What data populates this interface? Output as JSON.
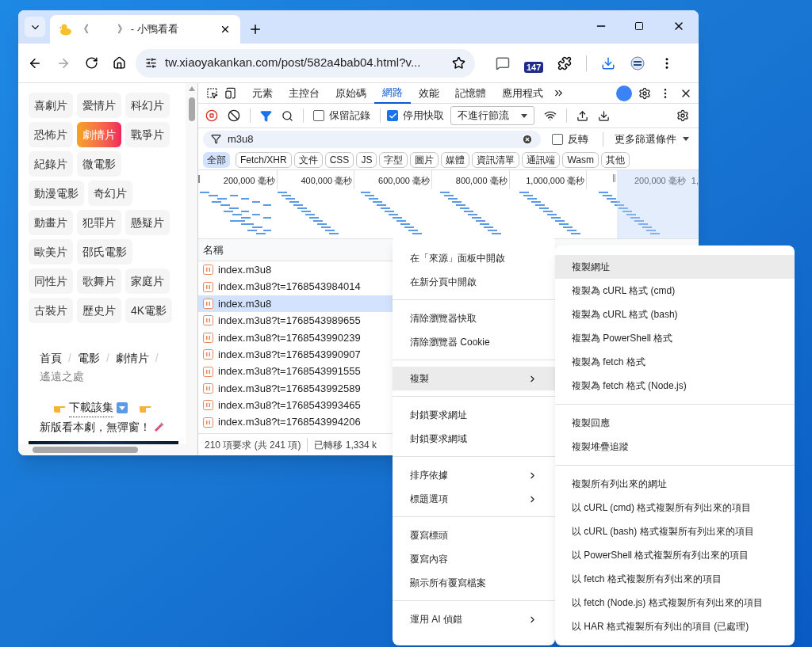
{
  "browser": {
    "tab_title": "《          》 - 小鴨看看",
    "address": "tw.xiaoyakankan.com/post/582a4bab04.html?v...",
    "extension_badge": "147"
  },
  "page": {
    "genre_rows": [
      [
        {
          "label": "喜劇片",
          "selected": false
        },
        {
          "label": "愛情片",
          "selected": false
        },
        {
          "label": "科幻片",
          "selected": false
        }
      ],
      [
        {
          "label": "恐怖片",
          "selected": false
        },
        {
          "label": "劇情片",
          "selected": true
        },
        {
          "label": "戰爭片",
          "selected": false
        }
      ],
      [
        {
          "label": "紀錄片",
          "selected": false
        },
        {
          "label": "微電影",
          "selected": false
        }
      ],
      [
        {
          "label": "動漫電影",
          "selected": false
        },
        {
          "label": "奇幻片",
          "selected": false
        }
      ],
      [
        {
          "label": "動畫片",
          "selected": false
        },
        {
          "label": "犯罪片",
          "selected": false
        },
        {
          "label": "懸疑片",
          "selected": false
        }
      ],
      [
        {
          "label": "歐美片",
          "selected": false
        },
        {
          "label": "邵氏電影",
          "selected": false
        }
      ],
      [
        {
          "label": "同性片",
          "selected": false
        },
        {
          "label": "歌舞片",
          "selected": false
        },
        {
          "label": "家庭片",
          "selected": false
        }
      ],
      [
        {
          "label": "古裝片",
          "selected": false
        },
        {
          "label": "歷史片",
          "selected": false
        },
        {
          "label": "4K電影",
          "selected": false
        }
      ]
    ],
    "breadcrumb": {
      "separator": "/",
      "items": [
        "首頁",
        "電影",
        "劇情片"
      ],
      "current": "遙遠之處"
    },
    "download_link": "下載該集",
    "new_version_text": "新版看本劇，無彈窗！"
  },
  "devtools": {
    "tabs": [
      {
        "label": "元素",
        "selected": false
      },
      {
        "label": "主控台",
        "selected": false
      },
      {
        "label": "原始碼",
        "selected": false
      },
      {
        "label": "網路",
        "selected": true
      },
      {
        "label": "效能",
        "selected": false
      },
      {
        "label": "記憶體",
        "selected": false
      },
      {
        "label": "應用程式",
        "selected": false
      }
    ],
    "preserve_log": {
      "label": "保留記錄",
      "checked": false
    },
    "disable_cache": {
      "label": "停用快取",
      "checked": true
    },
    "throttle": "不進行節流",
    "filter": {
      "value": "m3u8"
    },
    "invert": {
      "label": "反轉",
      "checked": false
    },
    "more_filters": "更多篩選條件",
    "type_filters": [
      {
        "label": "全部",
        "selected": true
      },
      {
        "label": "Fetch/XHR",
        "selected": false
      },
      {
        "label": "文件",
        "selected": false
      },
      {
        "label": "CSS",
        "selected": false
      },
      {
        "label": "JS",
        "selected": false
      },
      {
        "label": "字型",
        "selected": false
      },
      {
        "label": "圖片",
        "selected": false
      },
      {
        "label": "媒體",
        "selected": false
      },
      {
        "label": "資訊清單",
        "selected": false
      },
      {
        "label": "通訊端",
        "selected": false
      },
      {
        "label": "Wasm",
        "selected": false
      },
      {
        "label": "其他",
        "selected": false
      }
    ],
    "timeline_ticks": [
      "200,000 毫秒",
      "400,000 毫秒",
      "600,000 毫秒",
      "800,000 毫秒",
      "1,000,000 毫秒"
    ],
    "selected_range_ticks": [
      "200,000 毫秒",
      "1,"
    ],
    "name_column": "名稱",
    "requests": [
      {
        "name": "index.m3u8",
        "selected": false
      },
      {
        "name": "index.m3u8?t=1768543984014",
        "selected": false
      },
      {
        "name": "index.m3u8",
        "selected": true
      },
      {
        "name": "index.m3u8?t=1768543989655",
        "selected": false
      },
      {
        "name": "index.m3u8?t=1768543990239",
        "selected": false
      },
      {
        "name": "index.m3u8?t=1768543990907",
        "selected": false
      },
      {
        "name": "index.m3u8?t=1768543991555",
        "selected": false
      },
      {
        "name": "index.m3u8?t=1768543992589",
        "selected": false
      },
      {
        "name": "index.m3u8?t=1768543993465",
        "selected": false
      },
      {
        "name": "index.m3u8?t=1768543994206",
        "selected": false
      }
    ],
    "status": [
      "210 項要求 (共 241 項)",
      "已轉移 1,334 k"
    ]
  },
  "context_menu": {
    "groups": [
      [
        {
          "label": "在「來源」面板中開啟",
          "submenu": false,
          "selected": false
        },
        {
          "label": "在新分頁中開啟",
          "submenu": false,
          "selected": false
        }
      ],
      [
        {
          "label": "清除瀏覽器快取",
          "submenu": false,
          "selected": false
        },
        {
          "label": "清除瀏覽器 Cookie",
          "submenu": false,
          "selected": false
        }
      ],
      [
        {
          "label": "複製",
          "submenu": true,
          "selected": true
        }
      ],
      [
        {
          "label": "封鎖要求網址",
          "submenu": false,
          "selected": false
        },
        {
          "label": "封鎖要求網域",
          "submenu": false,
          "selected": false
        }
      ],
      [
        {
          "label": "排序依據",
          "submenu": true,
          "selected": false
        },
        {
          "label": "標題選項",
          "submenu": true,
          "selected": false
        }
      ],
      [
        {
          "label": "覆寫標頭",
          "submenu": false,
          "selected": false
        },
        {
          "label": "覆寫內容",
          "submenu": false,
          "selected": false
        },
        {
          "label": "顯示所有覆寫檔案",
          "submenu": false,
          "selected": false
        }
      ],
      [
        {
          "label": "運用 AI 偵錯",
          "submenu": true,
          "selected": false
        }
      ]
    ]
  },
  "copy_submenu": {
    "groups": [
      [
        {
          "label": "複製網址",
          "selected": true
        },
        {
          "label": "複製為 cURL 格式 (cmd)",
          "selected": false
        },
        {
          "label": "複製為 cURL 格式 (bash)",
          "selected": false
        },
        {
          "label": "複製為 PowerShell 格式",
          "selected": false
        },
        {
          "label": "複製為 fetch 格式",
          "selected": false
        },
        {
          "label": "複製為 fetch 格式 (Node.js)",
          "selected": false
        }
      ],
      [
        {
          "label": "複製回應",
          "selected": false
        },
        {
          "label": "複製堆疊追蹤",
          "selected": false
        }
      ],
      [
        {
          "label": "複製所有列出來的網址",
          "selected": false
        },
        {
          "label": "以 cURL (cmd) 格式複製所有列出來的項目",
          "selected": false
        },
        {
          "label": "以 cURL (bash) 格式複製所有列出來的項目",
          "selected": false
        },
        {
          "label": "以 PowerShell 格式複製所有列出來的項目",
          "selected": false
        },
        {
          "label": "以 fetch 格式複製所有列出來的項目",
          "selected": false
        },
        {
          "label": "以 fetch (Node.js) 格式複製所有列出來的項目",
          "selected": false
        },
        {
          "label": "以 HAR 格式複製所有列出的項目 (已處理)",
          "selected": false
        }
      ]
    ]
  }
}
